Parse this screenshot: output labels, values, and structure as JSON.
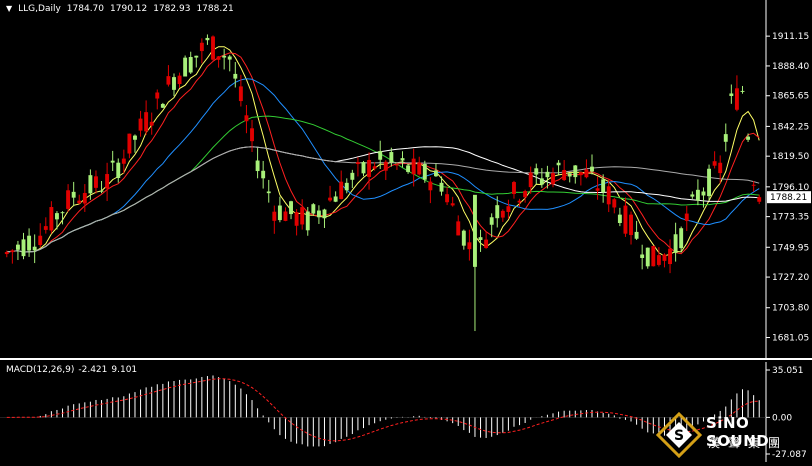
{
  "header": {
    "arrow_icon": "triangle-down-icon",
    "symbol": "LLG,Daily",
    "ohlc": [
      "1784.70",
      "1790.12",
      "1782.93",
      "1788.21"
    ]
  },
  "macd_header": {
    "label": "MACD(12,26,9)",
    "values": [
      "-2.421",
      "9.101"
    ]
  },
  "logo": {
    "brand": "SiNO SOUND",
    "chinese": "漢聲集團",
    "icon": "diamond-s-logo-icon"
  },
  "colors": {
    "background": "#000000",
    "bull": "#e00000",
    "bear": "#a8f07a",
    "ma_fast": "#ffff66",
    "ma_red": "#ff2020",
    "ma_blue": "#1f8fff",
    "ma_green": "#33cc33",
    "ma_white": "#ffffff",
    "ma_gray": "#aaaaaa",
    "macd_hist": "#ffffff",
    "macd_signal": "#ff2020",
    "price_tag": "#ffffff"
  },
  "chart_data": [
    {
      "type": "candlestick",
      "title": "LLG,Daily",
      "ylim": [
        1670,
        1925
      ],
      "yticks": [
        "1911.15",
        "1888.40",
        "1865.65",
        "1842.25",
        "1819.50",
        "1796.10",
        "1773.35",
        "1749.95",
        "1727.20",
        "1703.80",
        "1681.05"
      ],
      "current_price": "1788.21",
      "bar_count": 136,
      "candles_sample": [
        {
          "i": 0,
          "o": 1745,
          "h": 1760,
          "l": 1735,
          "c": 1755
        },
        {
          "i": 10,
          "o": 1775,
          "h": 1800,
          "l": 1770,
          "c": 1792
        },
        {
          "i": 22,
          "o": 1820,
          "h": 1840,
          "l": 1800,
          "c": 1835
        },
        {
          "i": 34,
          "o": 1900,
          "h": 1918,
          "l": 1885,
          "c": 1905
        },
        {
          "i": 45,
          "o": 1840,
          "h": 1860,
          "l": 1790,
          "c": 1800
        },
        {
          "i": 56,
          "o": 1770,
          "h": 1790,
          "l": 1760,
          "c": 1785
        },
        {
          "i": 70,
          "o": 1820,
          "h": 1830,
          "l": 1795,
          "c": 1800
        },
        {
          "i": 84,
          "o": 1790,
          "h": 1800,
          "l": 1690,
          "c": 1730
        },
        {
          "i": 103,
          "o": 1815,
          "h": 1830,
          "l": 1790,
          "c": 1800
        },
        {
          "i": 116,
          "o": 1750,
          "h": 1760,
          "l": 1730,
          "c": 1740
        },
        {
          "i": 127,
          "o": 1845,
          "h": 1875,
          "l": 1840,
          "c": 1870
        },
        {
          "i": 135,
          "o": 1784.7,
          "h": 1790.12,
          "l": 1782.93,
          "c": 1788.21
        }
      ],
      "moving_averages": [
        "fast (yellow)",
        "red",
        "blue",
        "green",
        "white",
        "gray"
      ]
    },
    {
      "type": "bar",
      "title": "MACD(12,26,9)",
      "values_shown": [
        "-2.421",
        "9.101"
      ],
      "yticks": [
        "35.051",
        "0.00",
        "-27.087"
      ],
      "ylim": [
        -27.087,
        35.051
      ]
    }
  ]
}
